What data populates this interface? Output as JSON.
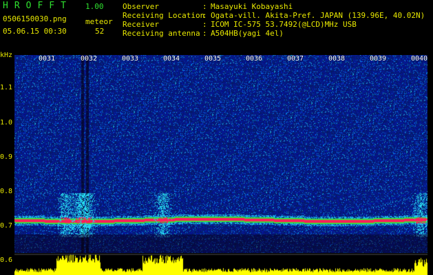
{
  "app": {
    "title": "HROFFT",
    "version": "1.00"
  },
  "file": {
    "name": "0506150030.png",
    "datetime": "05.06.15 00:30"
  },
  "meteor": {
    "label": "meteor",
    "count": "52"
  },
  "info": [
    {
      "key": "Observer",
      "value": "Masayuki Kobayashi"
    },
    {
      "key": "Receiving Location",
      "value": "Ogata-vill. Akita-Pref. JAPAN (139.96E, 40.02N)"
    },
    {
      "key": "Receiver",
      "value": "ICOM IC-575 53.7492(@LCD)MHz USB"
    },
    {
      "key": "Receiving antenna",
      "value": "A504HB(yagi 4el)"
    }
  ],
  "axis": {
    "unit": "kHz",
    "y_ticks": [
      "1.1",
      "1.0",
      "0.9",
      "0.8",
      "0.7",
      "0.6"
    ],
    "y_values": [
      1.1,
      1.0,
      0.9,
      0.8,
      0.7,
      0.6
    ],
    "x_ticks": [
      "0031",
      "0032",
      "0033",
      "0034",
      "0035",
      "0036",
      "0037",
      "0038",
      "0039",
      "0040"
    ]
  },
  "colors": {
    "background": "#000000",
    "label_yellow": "#e8e800",
    "title_green": "#2fe02f",
    "spectrum_base": "#0a1a90",
    "signal_band": "#ff2060",
    "bar_fill": "#ffff00"
  }
}
